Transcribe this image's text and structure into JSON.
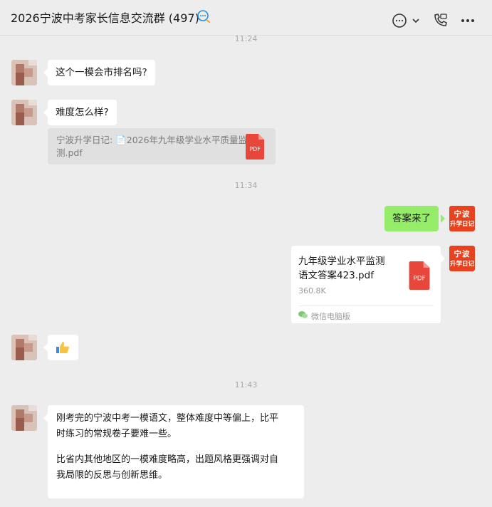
{
  "header": {
    "title": "2026宁波中考家长信息交流群 (497)",
    "icons": [
      "group-chat-icon",
      "chat-bubble-icon",
      "chevron-down-icon",
      "phone-icon",
      "more-icon"
    ]
  },
  "timestamps": [
    "11:24",
    "11:34",
    "11:43"
  ],
  "messages": [
    {
      "text": "这个一模会市排名吗?"
    },
    {
      "text": "难度怎么样?",
      "quote": {
        "line1": "宁波升学日记: 📄2026年九年级学业水平质量监",
        "line2": "测.pdf"
      }
    },
    {
      "text": "答案来了"
    },
    {
      "file": {
        "name_line1": "九年级学业水平监测",
        "name_line2": "语文答案423.pdf",
        "size": "360.8K",
        "source": "微信电脑版"
      }
    },
    {
      "emoji": "thumbs-up-icon"
    },
    {
      "lines": [
        "刚考完的宁波中考一模语文，整体难度中等偏上，比平",
        "时练习的常规卷子要难一些。",
        "比省内其他地区的一模难度略高，出题风格更强调对自",
        "我局限的反思与创新思维。"
      ]
    }
  ],
  "brand_avatar": {
    "line1": "宁波",
    "line2": "升学日记"
  },
  "pdf_label": "PDF",
  "colors": {
    "pdf": "#e8463b",
    "my_bubble": "#95ec69",
    "brand": "#e8421e"
  }
}
